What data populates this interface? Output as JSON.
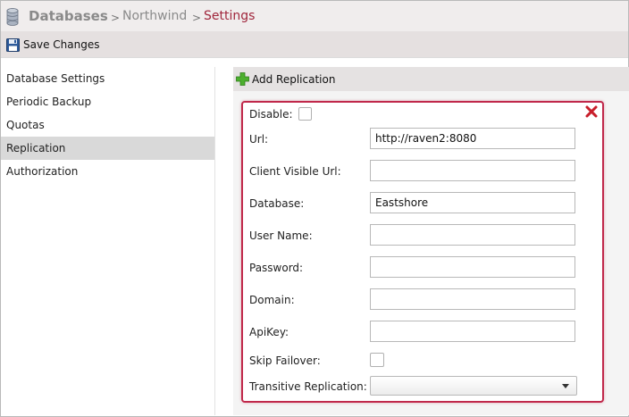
{
  "breadcrumb": {
    "root": "Databases",
    "separator": ">",
    "middle": "Northwind",
    "current": "Settings"
  },
  "toolbar": {
    "save_label": "Save Changes",
    "save_icon": "floppy-disk-icon"
  },
  "sidebar": {
    "items": [
      {
        "label": "Database Settings",
        "active": false
      },
      {
        "label": "Periodic Backup",
        "active": false
      },
      {
        "label": "Quotas",
        "active": false
      },
      {
        "label": "Replication",
        "active": true
      },
      {
        "label": "Authorization",
        "active": false
      }
    ]
  },
  "replication": {
    "add_label": "Add Replication",
    "add_icon": "plus-icon",
    "close_icon": "close-icon",
    "accent_color": "#c0284a",
    "form": {
      "disable_label": "Disable:",
      "url_label": "Url:",
      "url_value": "http://raven2:8080",
      "client_visible_url_label": "Client Visible Url:",
      "client_visible_url_value": "",
      "database_label": "Database:",
      "database_value": "Eastshore",
      "username_label": "User Name:",
      "username_value": "",
      "password_label": "Password:",
      "password_value": "",
      "domain_label": "Domain:",
      "domain_value": "",
      "apikey_label": "ApiKey:",
      "apikey_value": "",
      "skip_failover_label": "Skip Failover:",
      "transitive_label": "Transitive Replication:",
      "transitive_value": ""
    }
  }
}
